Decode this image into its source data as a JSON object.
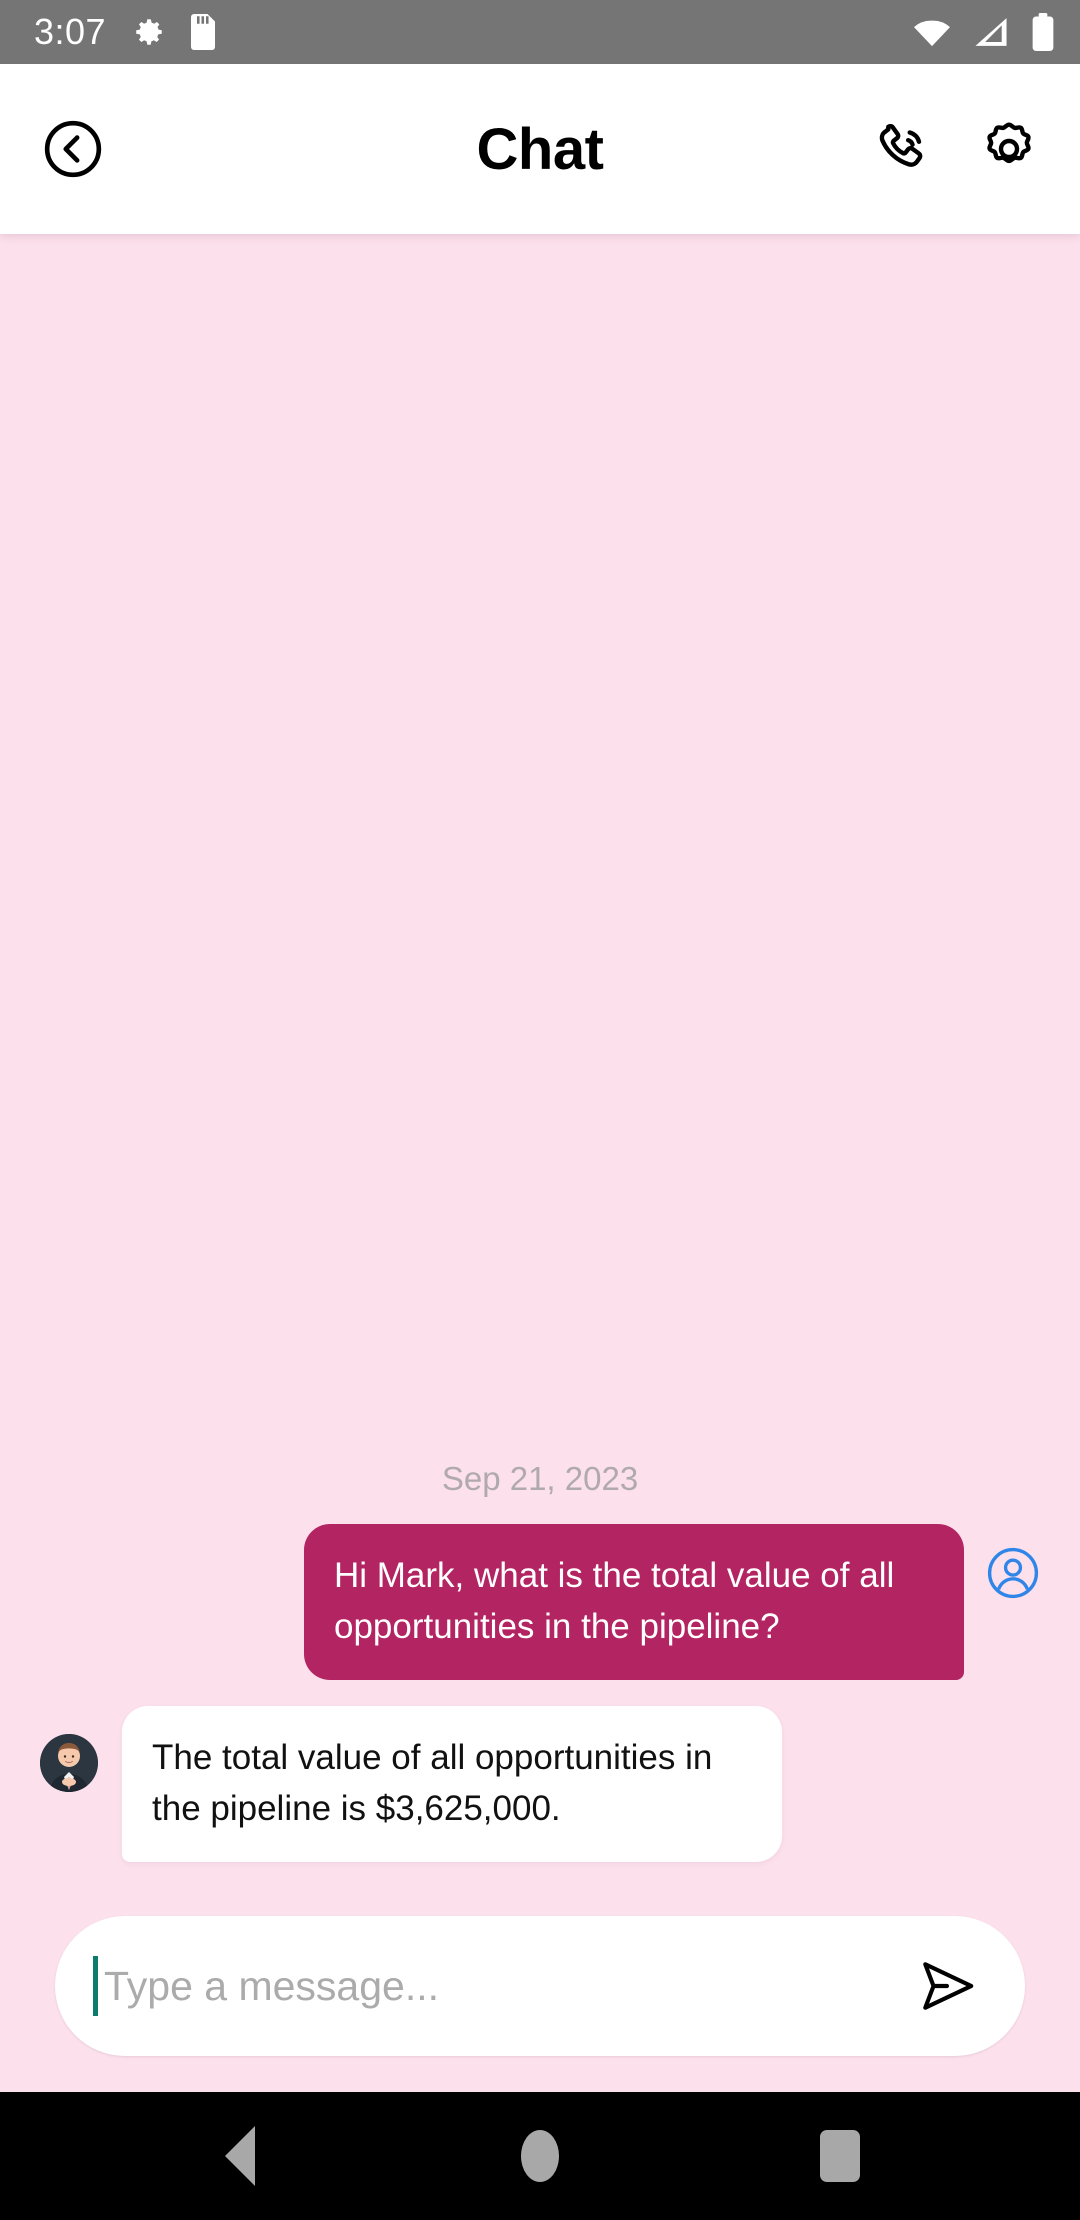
{
  "status_bar": {
    "time": "3:07",
    "left_icons": [
      "gear-icon",
      "sd-card-icon"
    ],
    "right_icons": [
      "wifi-icon",
      "cellular-signal-icon",
      "battery-icon"
    ],
    "background_color": "#757575"
  },
  "header": {
    "title": "Chat",
    "back_label": "Back",
    "call_label": "Call",
    "settings_label": "Settings",
    "background_color": "#FFFFFF"
  },
  "chat": {
    "background_color": "#FCE0EC",
    "date_divider": "Sep 21, 2023",
    "outgoing_color": "#B32462",
    "incoming_color": "#FFFFFF",
    "messages": [
      {
        "direction": "outgoing",
        "sender": "user",
        "text": "Hi Mark, what is the total value of all opportunities in the pipeline?",
        "avatar": "user-avatar-icon"
      },
      {
        "direction": "incoming",
        "sender": "Mark",
        "text": "The total value of all opportunities in the pipeline is $3,625,000.",
        "avatar": "agent-avatar-photo"
      }
    ]
  },
  "composer": {
    "placeholder": "Type a message...",
    "value": "",
    "send_label": "Send",
    "caret_color": "#0B7B6E"
  },
  "nav_bar": {
    "back_label": "Back",
    "home_label": "Home",
    "recents_label": "Recents",
    "background_color": "#000000"
  }
}
